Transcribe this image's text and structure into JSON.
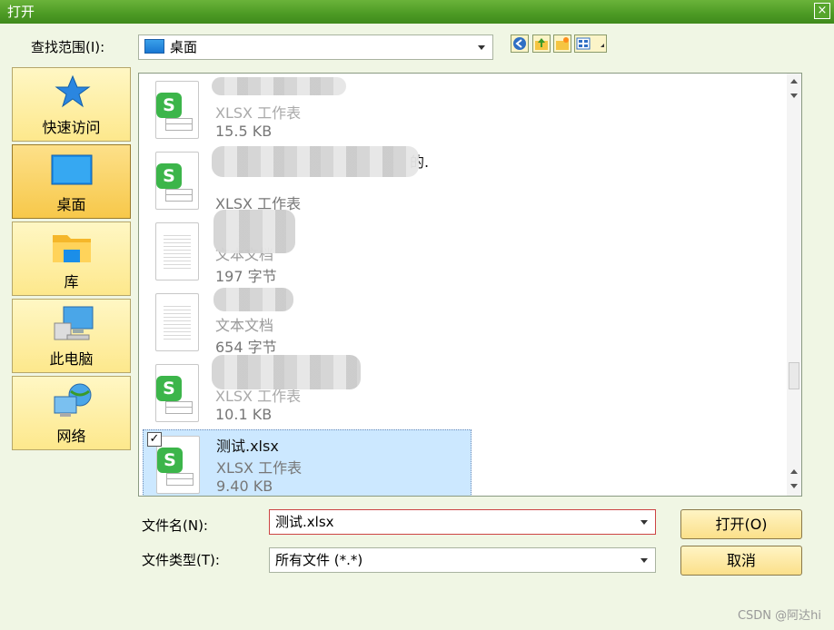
{
  "window": {
    "title": "打开",
    "close_label": "×"
  },
  "lookin": {
    "label": "查找范围(I):",
    "value": "桌面"
  },
  "places": [
    {
      "label": "快速访问",
      "icon": "star-icon"
    },
    {
      "label": "桌面",
      "icon": "desktop-icon"
    },
    {
      "label": "库",
      "icon": "folder-icon"
    },
    {
      "label": "此电脑",
      "icon": "computer-icon"
    },
    {
      "label": "网络",
      "icon": "network-icon"
    }
  ],
  "files": [
    {
      "name": "",
      "type": "XLSX 工作表",
      "size": "15.5 KB",
      "icon": "spreadsheet-icon"
    },
    {
      "name": "的.",
      "type": "XLSX 工作表",
      "size": "",
      "icon": "spreadsheet-icon"
    },
    {
      "name": "",
      "type": "文本文档",
      "size": "197 字节",
      "icon": "text-document-icon"
    },
    {
      "name": "",
      "type": "文本文档",
      "size": "654 字节",
      "icon": "text-document-icon"
    },
    {
      "name": "",
      "type": "XLSX 工作表",
      "size": "10.1 KB",
      "icon": "spreadsheet-icon"
    },
    {
      "name": "测试.xlsx",
      "type": "XLSX 工作表",
      "size": "9.40 KB",
      "icon": "spreadsheet-icon",
      "selected": true
    }
  ],
  "filename": {
    "label": "文件名(N):",
    "value": "测试.xlsx"
  },
  "filetype": {
    "label": "文件类型(T):",
    "value": "所有文件 (*.*)"
  },
  "buttons": {
    "open": "打开(O)",
    "cancel": "取消"
  },
  "watermark": "CSDN @阿达hi",
  "colors": {
    "accent": "#4c9a24",
    "selection": "#cce8ff",
    "button": "#fbe08a"
  }
}
